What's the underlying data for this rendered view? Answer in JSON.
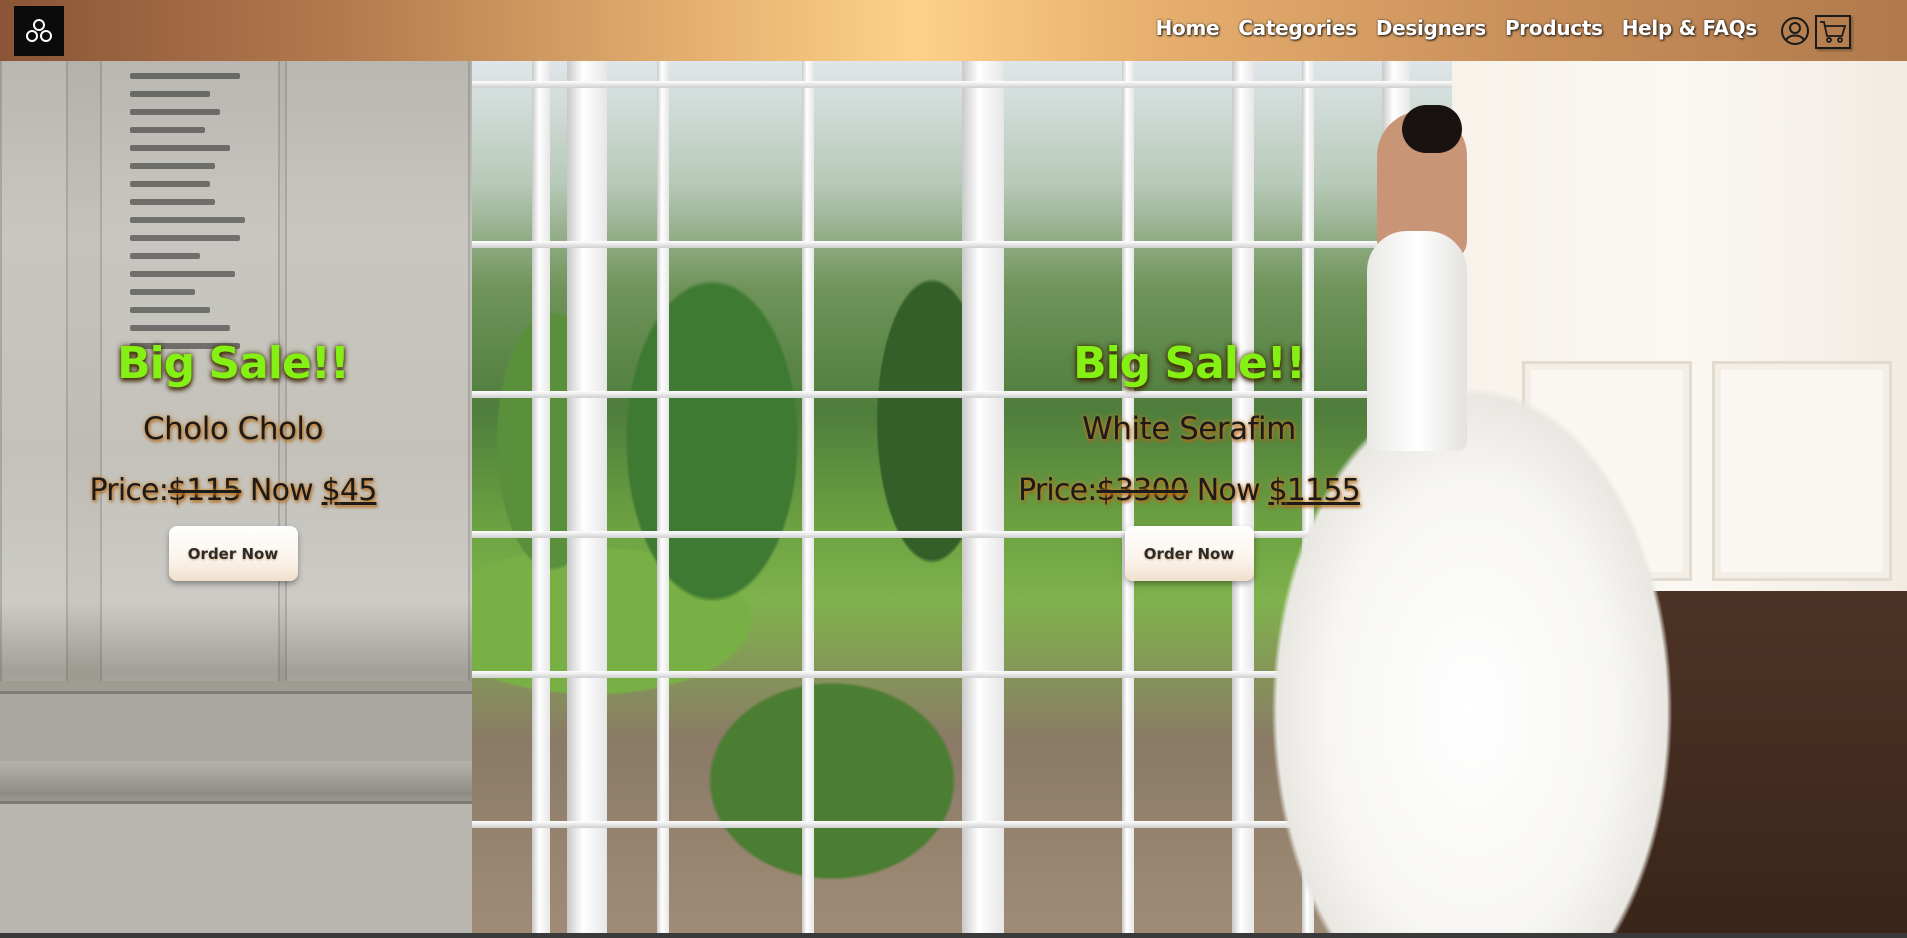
{
  "header": {
    "nav": [
      "Home",
      "Categories",
      "Designers",
      "Products",
      "Help & FAQs"
    ],
    "user_icon": "user-circle-icon",
    "cart_icon": "shopping-cart-icon",
    "logo_icon": "brand-logo-icon"
  },
  "slides": [
    {
      "badge": "Big Sale!!",
      "product": "Cholo Cholo",
      "price_label": "Price:",
      "old_price": "$115",
      "now_label": "Now",
      "currency": "$",
      "new_price": "45",
      "button": "Order Now"
    },
    {
      "badge": "Big Sale!!",
      "product": "White Serafim",
      "price_label": "Price:",
      "old_price": "$3300",
      "now_label": "Now",
      "currency": "$",
      "new_price": "1155",
      "button": "Order Now"
    }
  ],
  "colors": {
    "sale_text": "#84f013",
    "header_gradient_center": "#fdd189",
    "header_gradient_edge": "#8a5536"
  }
}
